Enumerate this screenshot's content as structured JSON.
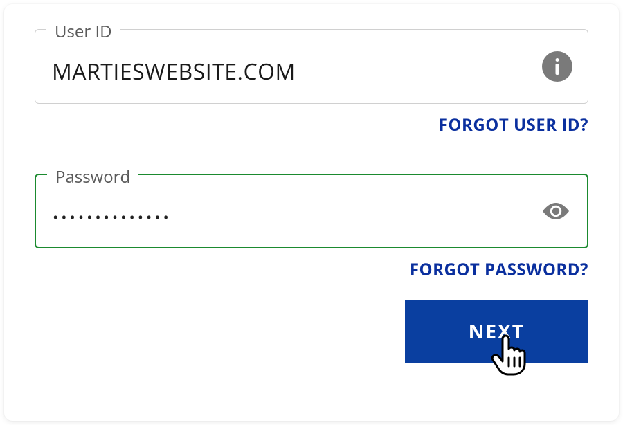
{
  "userId": {
    "label": "User ID",
    "value": "MARTIESWEBSITE.COM",
    "forgotLink": "FORGOT USER ID?"
  },
  "password": {
    "label": "Password",
    "mask": "••••••••••••••",
    "forgotLink": "FORGOT PASSWORD?"
  },
  "nextButton": "NEXT",
  "colors": {
    "accent": "#0a3fa0",
    "link": "#0a2f9e",
    "activeBorder": "#1b8a2f",
    "iconGrey": "#7a7a7a"
  }
}
